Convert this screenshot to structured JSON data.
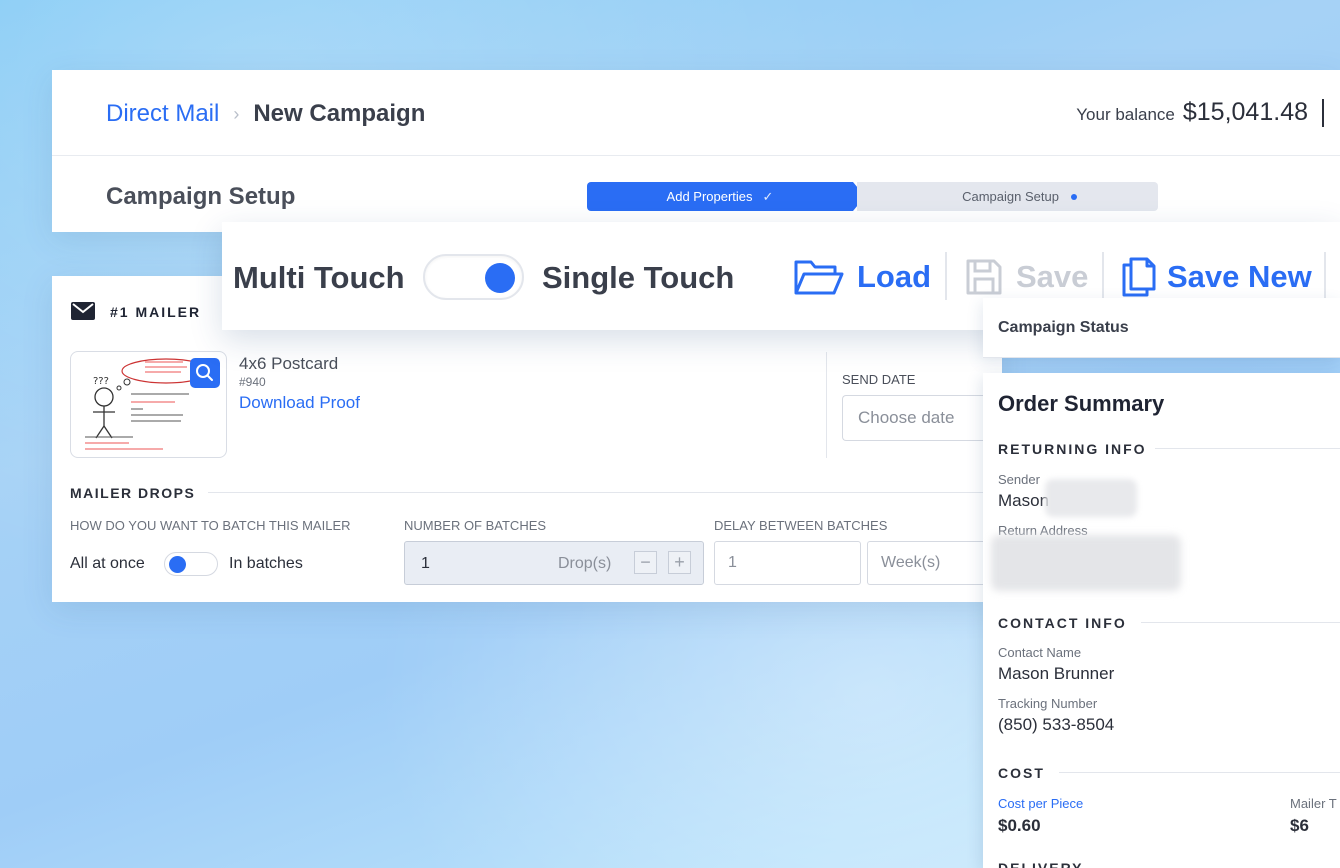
{
  "breadcrumb": {
    "root": "Direct Mail",
    "separator": "›",
    "current": "New Campaign"
  },
  "balance": {
    "label": "Your balance",
    "value": "$15,041.48"
  },
  "page": {
    "title": "Campaign Setup"
  },
  "stepper": {
    "steps": [
      {
        "label": "Add Properties",
        "state": "completed"
      },
      {
        "label": "Campaign Setup",
        "state": "active"
      }
    ]
  },
  "toolbar": {
    "multi_label": "Multi Touch",
    "single_label": "Single Touch",
    "touch_mode": "single",
    "load_label": "Load",
    "save_label": "Save",
    "save_new_label": "Save New"
  },
  "mailer": {
    "label": "#1 MAILER",
    "product_name": "4x6 Postcard",
    "product_id": "#940",
    "download_label": "Download Proof",
    "send_date_label": "SEND DATE",
    "send_date_placeholder": "Choose date"
  },
  "drops": {
    "title": "MAILER DROPS",
    "batch_question": "HOW DO YOU WANT TO BATCH THIS MAILER",
    "all_at_once": "All at once",
    "in_batches": "In batches",
    "batch_mode": "all-at-once",
    "num_batches_label": "NUMBER OF BATCHES",
    "num_batches_value": "1",
    "num_batches_unit": "Drop(s)",
    "delay_label": "DELAY BETWEEN BATCHES",
    "delay_value": "1",
    "delay_unit": "Week(s)"
  },
  "status": {
    "title": "Campaign Status"
  },
  "order": {
    "title": "Order Summary",
    "returning_title": "RETURNING INFO",
    "sender_label": "Sender",
    "sender_value": "Mason",
    "return_address_label": "Return Address",
    "contact_title": "CONTACT INFO",
    "contact_name_label": "Contact Name",
    "contact_name_value": "Mason Brunner",
    "tracking_label": "Tracking Number",
    "tracking_value": "(850) 533-8504",
    "cost_title": "COST",
    "cost_per_piece_label": "Cost per Piece",
    "cost_per_piece_value": "$0.60",
    "mailer_total_label": "Mailer T",
    "mailer_total_value": "$6",
    "delivery_title": "DELIVERY"
  },
  "colors": {
    "accent": "#2a6df4",
    "text": "#2b2f3a",
    "muted": "#6b717c"
  }
}
